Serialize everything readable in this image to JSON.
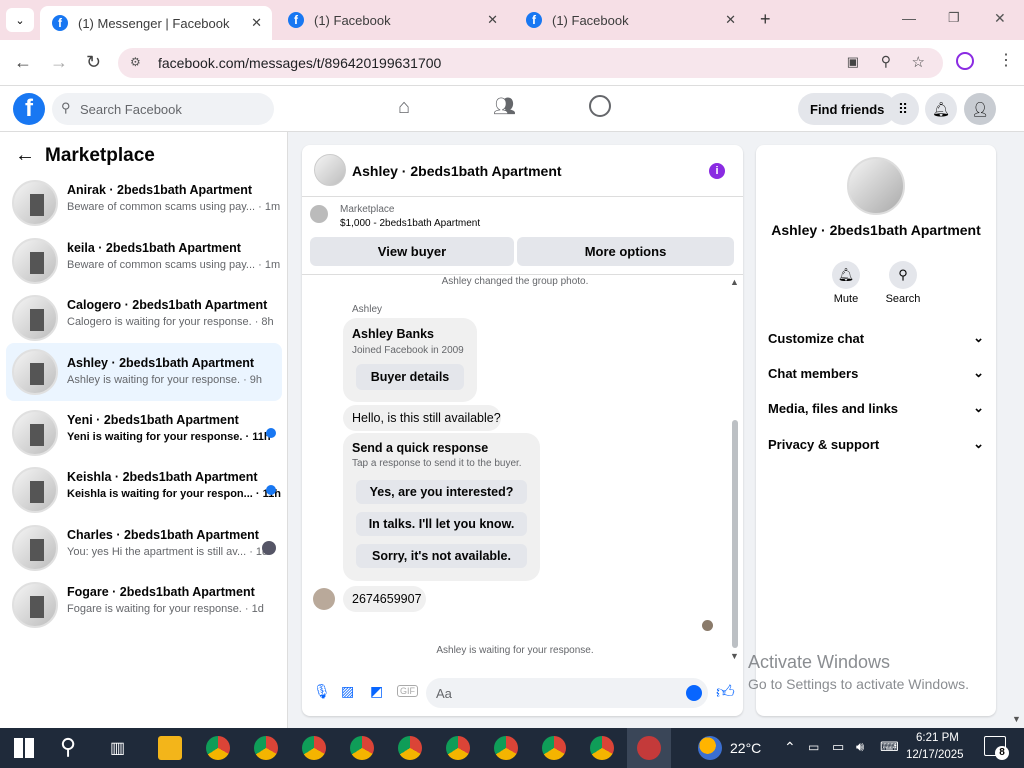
{
  "browser": {
    "tabs": [
      {
        "title": "(1) Messenger | Facebook",
        "active": true
      },
      {
        "title": "(1) Facebook",
        "active": false
      },
      {
        "title": "(1) Facebook",
        "active": false
      }
    ],
    "url": "facebook.com/messages/t/896420199631700"
  },
  "fb_header": {
    "logo": "f",
    "search_placeholder": "Search Facebook",
    "find_friends": "Find friends"
  },
  "left_panel": {
    "title": "Marketplace",
    "conversations": [
      {
        "name": "Anirak · 2beds1bath Apartment",
        "preview": "Beware of common scams using pay... · 1m",
        "unread": false,
        "selected": false
      },
      {
        "name": "keila · 2beds1bath Apartment",
        "preview": "Beware of common scams using pay... · 1m",
        "unread": false,
        "selected": false
      },
      {
        "name": "Calogero · 2beds1bath Apartment",
        "preview": "Calogero is waiting for your response. · 8h",
        "unread": false,
        "selected": false
      },
      {
        "name": "Ashley · 2beds1bath Apartment",
        "preview": "Ashley is waiting for your response. · 9h",
        "unread": false,
        "selected": true
      },
      {
        "name": "Yeni · 2beds1bath Apartment",
        "preview": "Yeni is waiting for your response. · 11h",
        "unread": true,
        "selected": false
      },
      {
        "name": "Keishla · 2beds1bath Apartment",
        "preview": "Keishla is waiting for your respon... · 11h",
        "unread": true,
        "selected": false
      },
      {
        "name": "Charles · 2beds1bath Apartment",
        "preview": "You: yes Hi the apartment is still av... · 1d",
        "unread": false,
        "selected": false
      },
      {
        "name": "Fogare · 2beds1bath Apartment",
        "preview": "Fogare is waiting for your response. · 1d",
        "unread": false,
        "selected": false
      }
    ]
  },
  "chat": {
    "title": "Ashley · 2beds1bath Apartment",
    "info_icon": "i",
    "marketplace_label": "Marketplace",
    "listing": "$1,000 - 2beds1bath Apartment",
    "view_buyer": "View buyer",
    "more_options": "More options",
    "system_photo": "Ashley changed the group photo.",
    "sender_label": "Ashley",
    "buyer_card": {
      "name": "Ashley Banks",
      "joined": "Joined Facebook in 2009",
      "button": "Buyer details"
    },
    "message1": "Hello, is this still available?",
    "quick": {
      "title": "Send a quick response",
      "subtitle": "Tap a response to send it to the buyer.",
      "options": [
        "Yes, are you interested?",
        "In talks. I'll let you know.",
        "Sorry, it's not available."
      ]
    },
    "message2": "2674659907",
    "waiting": "Ashley is waiting for your response.",
    "composer_placeholder": "Aa"
  },
  "right_panel": {
    "name": "Ashley · 2beds1bath Apartment",
    "actions": [
      "Mute",
      "Search"
    ],
    "sections": [
      "Customize chat",
      "Chat members",
      "Media, files and links",
      "Privacy & support"
    ]
  },
  "watermark": {
    "line1": "Activate Windows",
    "line2": "Go to Settings to activate Windows."
  },
  "taskbar": {
    "weather": "22°C",
    "time": "6:21 PM",
    "date": "12/17/2025",
    "notifications": "8"
  },
  "colors": {
    "accent": "#1877f2",
    "selected": "#ebf5ff",
    "info": "#8a2be2"
  }
}
